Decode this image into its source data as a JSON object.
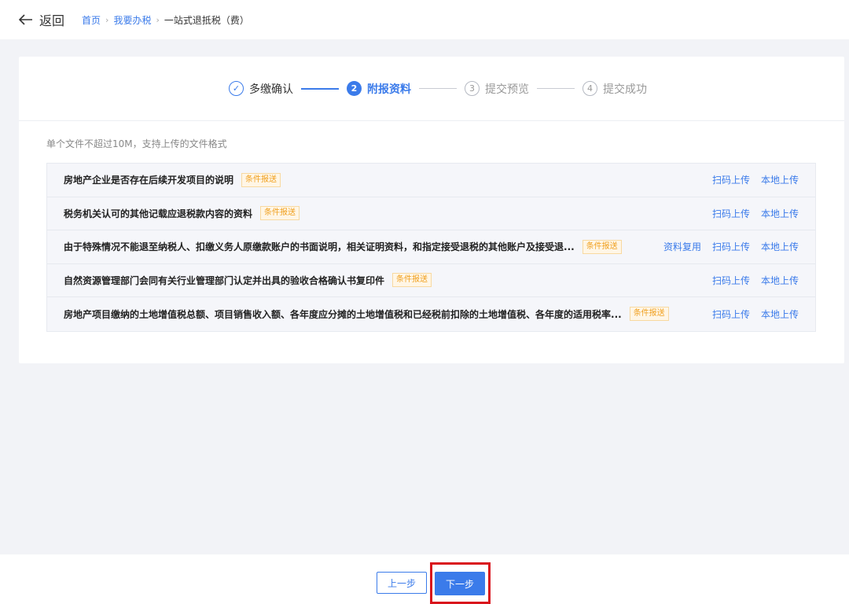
{
  "header": {
    "back_label": "返回",
    "breadcrumbs": [
      "首页",
      "我要办税",
      "一站式退抵税（费）"
    ]
  },
  "steps": [
    {
      "num": "✓",
      "label": "多缴确认",
      "state": "done"
    },
    {
      "num": "2",
      "label": "附报资料",
      "state": "active"
    },
    {
      "num": "3",
      "label": "提交预览",
      "state": "todo"
    },
    {
      "num": "4",
      "label": "提交成功",
      "state": "todo"
    }
  ],
  "tip": "单个文件不超过10M，支持上传的文件格式",
  "files": [
    {
      "title": "房地产企业是否存在后续开发项目的说明",
      "badge": "条件报送",
      "actions": [
        "扫码上传",
        "本地上传"
      ]
    },
    {
      "title": "税务机关认可的其他记载应退税款内容的资料",
      "badge": "条件报送",
      "actions": [
        "扫码上传",
        "本地上传"
      ]
    },
    {
      "title": "由于特殊情况不能退至纳税人、扣缴义务人原缴款账户的书面说明，相关证明资料，和指定接受退税的其他账户及接受退...",
      "badge": "条件报送",
      "actions": [
        "资料复用",
        "扫码上传",
        "本地上传"
      ]
    },
    {
      "title": "自然资源管理部门会同有关行业管理部门认定并出具的验收合格确认书复印件",
      "badge": "条件报送",
      "actions": [
        "扫码上传",
        "本地上传"
      ]
    },
    {
      "title": "房地产项目缴纳的土地增值税总额、项目销售收入额、各年度应分摊的土地增值税和已经税前扣除的土地增值税、各年度的适用税率...",
      "badge": "条件报送",
      "actions": [
        "扫码上传",
        "本地上传"
      ]
    }
  ],
  "footer": {
    "prev_label": "上一步",
    "next_label": "下一步"
  },
  "colors": {
    "accent": "#3b7bea",
    "badge": "#f0a020",
    "highlight": "#d9141c"
  }
}
